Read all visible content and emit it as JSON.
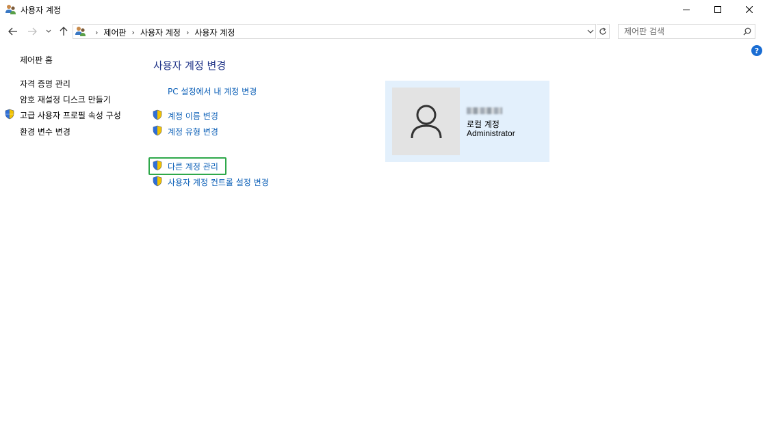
{
  "window": {
    "title": "사용자 계정",
    "icon": "users-icon",
    "controls": {
      "minimize": "minimize-icon",
      "maximize": "maximize-icon",
      "close": "close-icon"
    }
  },
  "address_bar": {
    "crumbs": [
      "제어판",
      "사용자 계정",
      "사용자 계정"
    ]
  },
  "search": {
    "placeholder": "제어판 검색"
  },
  "help": {
    "label": "?"
  },
  "left_pane": {
    "items": [
      {
        "label": "제어판 홈",
        "shield": false
      },
      {
        "label": "자격 증명 관리",
        "shield": false
      },
      {
        "label": "암호 재설정 디스크 만들기",
        "shield": false
      },
      {
        "label": "고급 사용자 프로필 속성 구성",
        "shield": true
      },
      {
        "label": "환경 변수 변경",
        "shield": false
      }
    ]
  },
  "main": {
    "title": "사용자 계정 변경",
    "tasks": [
      {
        "label": "PC 설정에서 내 계정 변경",
        "shield": false
      },
      {
        "label": "계정 이름 변경",
        "shield": true
      },
      {
        "label": "계정 유형 변경",
        "shield": true
      },
      {
        "label": "다른 계정 관리",
        "shield": true,
        "highlighted": true
      },
      {
        "label": "사용자 계정 컨트롤 설정 변경",
        "shield": true
      }
    ]
  },
  "user_card": {
    "account_type": "로컬 계정",
    "role": "Administrator"
  },
  "colors": {
    "link": "#0b5fb7",
    "title": "#1e3287",
    "card_bg": "#e3f0fc",
    "highlight": "#2ea84a"
  }
}
